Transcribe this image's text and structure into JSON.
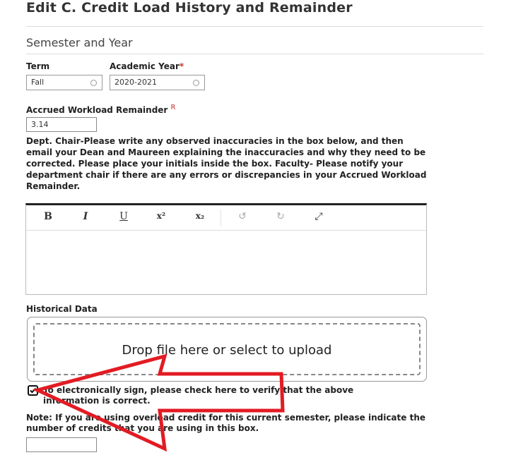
{
  "page": {
    "title": "Edit C. Credit Load History and Remainder",
    "section_title": "Semester and Year"
  },
  "term": {
    "label": "Term",
    "value": "Fall"
  },
  "academic_year": {
    "label": "Academic Year",
    "required_mark": "*",
    "value": "2020-2021"
  },
  "accrued": {
    "label": "Accrued Workload Remainder",
    "badge": "R",
    "value": "3.14"
  },
  "instructions": "Dept. Chair-Please write any observed inaccuracies in the box below, and then email your Dean and Maureen explaining the inaccuracies and why they need to be corrected. Please place your initials inside the box. Faculty- Please notify your department chair if there are any errors or discrepancies in your Accrued Workload Remainder.",
  "editor": {
    "bold": "B",
    "italic": "I",
    "underline": "U",
    "superscript": "x²",
    "subscript": "x₂",
    "undo": "↺",
    "redo": "↻",
    "expand": "⤢"
  },
  "historical": {
    "label": "Historical Data",
    "drop_text": "Drop file here or select to upload"
  },
  "signature": {
    "checked": true,
    "text": "To electronically sign, please check here to verify that the above information is correct."
  },
  "overload": {
    "note": "Note: If you are using overload credit for this current semester, please indicate the number of credits that you are using in this box.",
    "value": ""
  },
  "colors": {
    "required": "#c9302c",
    "annotation_arrow": "#e31b23",
    "editor_top_border": "#222222"
  }
}
